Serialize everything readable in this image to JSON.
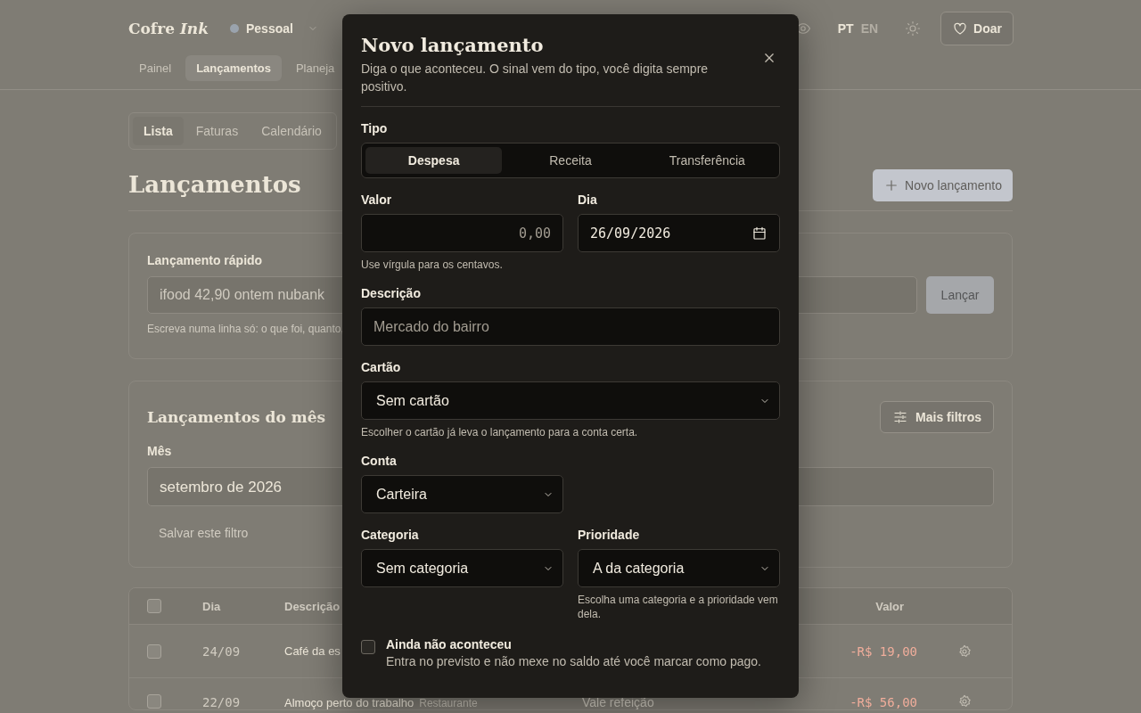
{
  "header": {
    "logo": "Cofre *Ink*",
    "workspace": {
      "name": "Pessoal",
      "color": "#9aa3ad"
    },
    "nav": [
      {
        "label": "Painel",
        "selected": false
      },
      {
        "label": "Lançamentos",
        "selected": true
      },
      {
        "label": "Planeja",
        "selected": false
      }
    ],
    "languages": [
      {
        "label": "PT",
        "selected": true
      },
      {
        "label": "EN",
        "selected": false
      }
    ],
    "donate_button": "Doar"
  },
  "view_tabs": [
    {
      "label": "Lista",
      "selected": true
    },
    {
      "label": "Faturas",
      "selected": false
    },
    {
      "label": "Calendário",
      "selected": false
    }
  ],
  "page_title": "Lançamentos",
  "new_button": "Novo lançamento",
  "quick_entry": {
    "label": "Lançamento rápido",
    "placeholder": "ifood 42,90 ontem nubank",
    "hint": "Escreva numa linha só: o que foi, quanto,",
    "button": {
      "label": "Lançar",
      "disabled": true
    }
  },
  "month_filter": {
    "title": "Lançamentos do mês",
    "filters_button": "Mais filtros",
    "month_label": "Mês",
    "month_value": "setembro de 2026",
    "save_link": "Salvar este filtro"
  },
  "table": {
    "columns": [
      "Dia",
      "Descrição",
      "Valor"
    ],
    "all_checked": false,
    "rows": [
      {
        "checked": false,
        "day": "24/09",
        "description": "Café da es",
        "amount": "-R$ 19,00"
      },
      {
        "checked": false,
        "day": "22/09",
        "description": "Almoço perto do trabalho",
        "tag": "Restaurante",
        "column_3": "Vale refeição",
        "amount": "-R$ 56,00"
      }
    ]
  },
  "dialog": {
    "title": "Novo lançamento",
    "subtitle": "Diga o que aconteceu. O sinal vem do tipo, você digita sempre positivo.",
    "type_label": "Tipo",
    "types": [
      {
        "label": "Despesa",
        "selected": true
      },
      {
        "label": "Receita",
        "selected": false
      },
      {
        "label": "Transferência",
        "selected": false
      }
    ],
    "amount": {
      "label": "Valor",
      "placeholder": "0,00",
      "hint": "Use vírgula para os centavos."
    },
    "date": {
      "label": "Dia",
      "value": "26/09/2026"
    },
    "description": {
      "label": "Descrição",
      "placeholder": "Mercado do bairro"
    },
    "card": {
      "label": "Cartão",
      "value": "Sem cartão",
      "hint": "Escolher o cartão já leva o lançamento para a conta certa."
    },
    "account": {
      "label": "Conta",
      "value": "Carteira"
    },
    "category": {
      "label": "Categoria",
      "value": "Sem categoria"
    },
    "priority": {
      "label": "Prioridade",
      "value": "A da categoria",
      "hint": "Escolha uma categoria e a prioridade vem dela."
    },
    "pending": {
      "label": "Ainda não aconteceu",
      "checked": false,
      "description": "Entra no previsto e não mexe no saldo até você marcar como pago."
    }
  }
}
